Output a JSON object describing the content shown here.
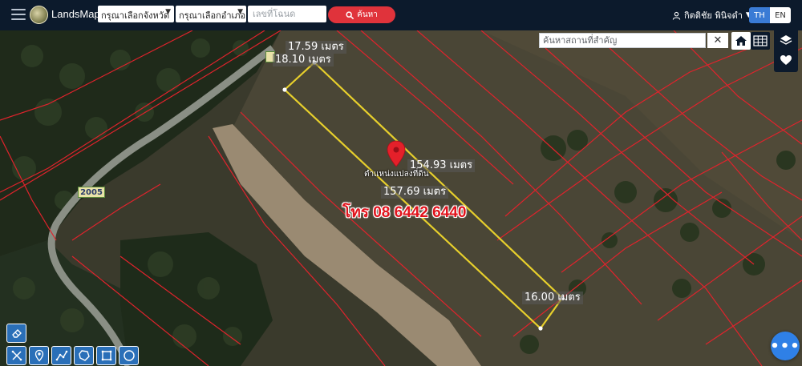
{
  "navbar": {
    "logo_text": "LandsMaps",
    "province_select": "กรุณาเลือกจังหวัด",
    "district_select": "กรุณาเลือกอำเภอ",
    "deed_placeholder": "เลขที่โฉนด",
    "search_label": "ค้นหา",
    "user_name": "กิตติชัย พินิจดำ",
    "lang_th": "TH",
    "lang_en": "EN"
  },
  "map": {
    "place_search_placeholder": "ค้นหาสถานที่สำคัญ",
    "close_label": "✕",
    "road_number": "2005",
    "pin_label": "ตำแหน่งแปลงที่ดิน",
    "phone_text": "โทร 08 6442 6440",
    "fab_label": "•••",
    "dimensions": {
      "top_a": "17.59 เมตร",
      "top_b": "18.10 เมตร",
      "long_a": "154.93 เมตร",
      "long_b": "157.69 เมตร",
      "bottom": "16.00 เมตร"
    }
  },
  "colors": {
    "navbar": "#0c1a2c",
    "search_button": "#e0333b",
    "plot_outline": "#e7cf2c",
    "parcel_lines": "#e0232c",
    "pin": "#e4202a",
    "tool_button": "#2a6fb8",
    "fab": "#2f80e6"
  }
}
